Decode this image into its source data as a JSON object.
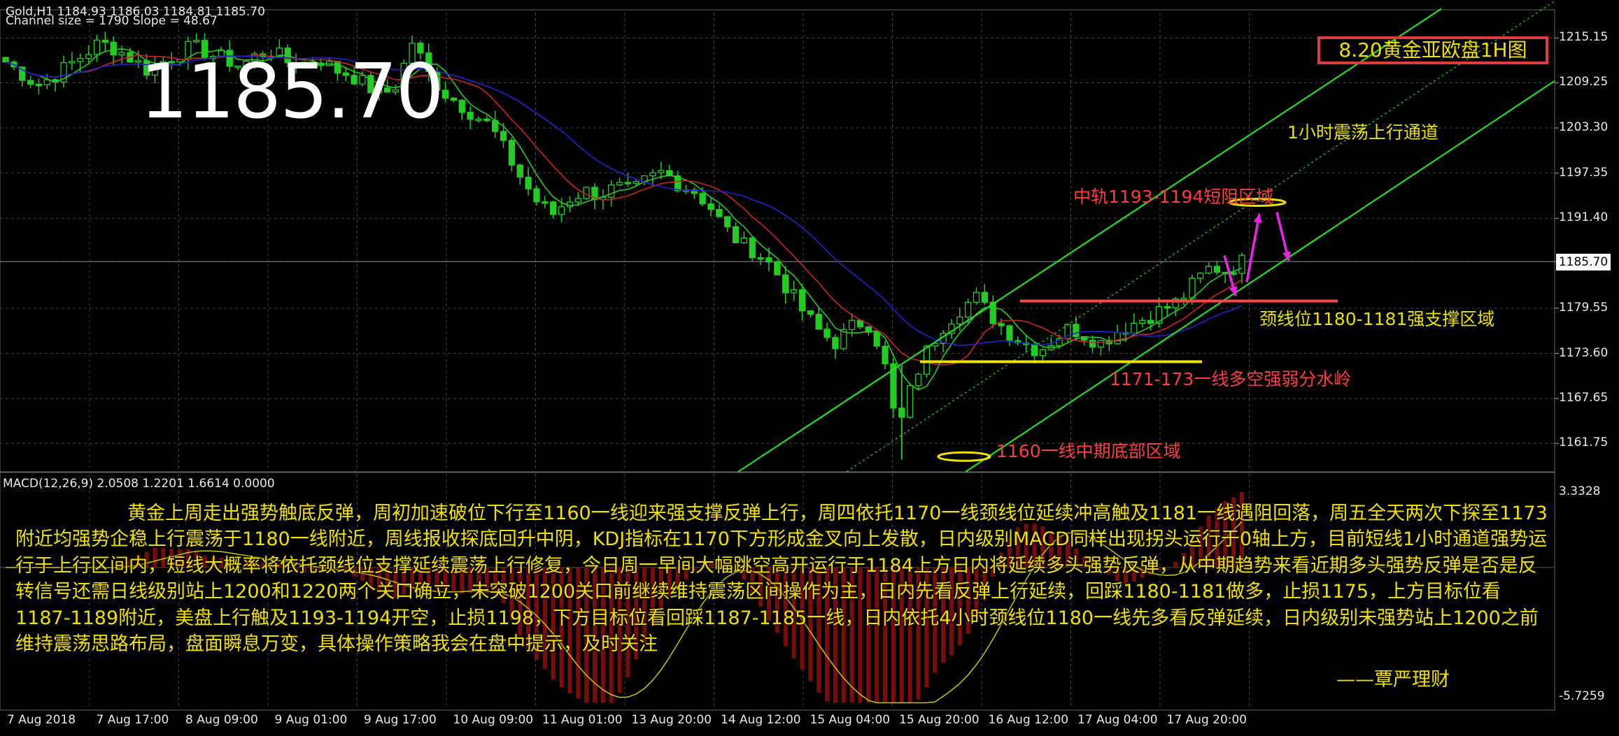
{
  "header": {
    "symbol_line": "Gold,H1  1184.93 1186.03 1184.81 1185.70",
    "channel_line": "Channel size = 1790 Slope = 48.67"
  },
  "big_price": "1185.70",
  "title_box": "8.20黄金亚欧盘1H图",
  "annotations": {
    "channel_label": "1小时震荡上行通道",
    "resistance_label": "中轨1193-1194短阻区域",
    "neckline_label": "颈线位1180-1181强支撑区域",
    "divide_label": "1171-173一线多空强弱分水岭",
    "bottom_label": "1160一线中期底部区域"
  },
  "macd_label": "MACD(12,26,9) 2.0508 1.2201 1.6614 0.0000",
  "colors": {
    "background": "#000000",
    "grid": "#3a4048",
    "bull_candle": "#22cc22",
    "bear_candle": "#22cc22",
    "channel": "#22dd22",
    "ma_fast": "#22cc22",
    "ma_mid": "#cc2222",
    "ma_slow": "#2222cc",
    "support_line": "#f0e000",
    "neckline": "#ff4444",
    "arrow": "#ee22ee",
    "text_yellow": "#f0e000",
    "text_red": "#ff3c3c"
  },
  "commentary": {
    "paragraph": "黄金上周走出强势触底反弹，周初加速破位下行至1160一线迎来强支撑反弹上行，周四依托1170一线颈线位延续冲高触及1181一线遇阻回落，周五全天两次下探至1173附近均强势企稳上行震荡于1180一线附近，周线报收探底回升中阴，KDJ指标在1170下方形成金叉向上发散，日内级别MACD同样出现拐头运行于0轴上方，目前短线1小时通道强势运行于上行区间内，短线大概率将依托颈线位支撑延续震荡上行修复，今日周一早间大幅跳空高开运行于1184上方日内将延续多头强势反弹，从中期趋势来看近期多头强势反弹是否是反转信号还需日线级别站上1200和1220两个关口确立，未突破1200关口前继续维持震荡区间操作为主，日内先看反弹上行延续，回踩1180-1181做多，止损1175，上方目标位看1187-1189附近，美盘上行触及1193-1194开空，止损1198，下方目标位看回踩1187-1185一线，日内依托4小时颈线位1180一线先多看反弹延续，日内级别未强势站上1200之前维持震荡思路布局，盘面瞬息万变，具体操作策略我会在盘中提示，及时关注",
    "signature": "——覃严理财"
  },
  "chart_data": {
    "type": "candlestick",
    "title": "8.20黄金亚欧盘1H图",
    "symbol": "Gold,H1",
    "last": 1185.7,
    "y_ticks": [
      "1215.15",
      "1209.25",
      "1203.30",
      "1197.35",
      "1191.40",
      "1185.70",
      "1179.55",
      "1173.60",
      "1167.65",
      "1161.75"
    ],
    "ylim": [
      1158.0,
      1218.5
    ],
    "macd_ticks": [
      "3.3328",
      "-5.7259"
    ],
    "macd_ylim": [
      -6.2,
      3.9
    ],
    "x_ticks": [
      "7 Aug 2018",
      "7 Aug 17:00",
      "8 Aug 09:00",
      "9 Aug 01:00",
      "9 Aug 17:00",
      "10 Aug 09:00",
      "11 Aug 01:00",
      "13 Aug 20:00",
      "14 Aug 12:00",
      "15 Aug 04:00",
      "15 Aug 20:00",
      "16 Aug 12:00",
      "17 Aug 04:00",
      "17 Aug 20:00"
    ],
    "levels": {
      "neckline": 1180.5,
      "divide": 1172.5,
      "bottom": 1160.0,
      "resistance": 1193.5
    },
    "close_path": [
      1212.0,
      1210.5,
      1209.0,
      1210.0,
      1211.5,
      1213.0,
      1214.5,
      1213.8,
      1212.5,
      1211.0,
      1212.0,
      1213.2,
      1214.0,
      1213.0,
      1212.4,
      1211.5,
      1212.8,
      1213.5,
      1212.0,
      1211.8,
      1212.5,
      1211.0,
      1210.4,
      1209.0,
      1207.5,
      1209.0,
      1214.8,
      1210.5,
      1208.0,
      1206.5,
      1205.0,
      1203.5,
      1200.0,
      1196.5,
      1193.5,
      1192.0,
      1194.0,
      1195.0,
      1194.5,
      1195.5,
      1194.8,
      1196.5,
      1197.5,
      1196.0,
      1195.0,
      1193.0,
      1190.0,
      1188.0,
      1187.0,
      1185.0,
      1182.0,
      1179.0,
      1176.5,
      1175.0,
      1177.0,
      1178.0,
      1174.0,
      1163.0,
      1170.0,
      1174.5,
      1177.5,
      1179.5,
      1181.0,
      1178.5,
      1176.5,
      1175.0,
      1174.0,
      1175.5,
      1177.0,
      1176.0,
      1175.0,
      1176.5,
      1177.5,
      1178.5,
      1179.5,
      1180.5,
      1183.0,
      1185.0,
      1184.5,
      1185.7
    ]
  }
}
